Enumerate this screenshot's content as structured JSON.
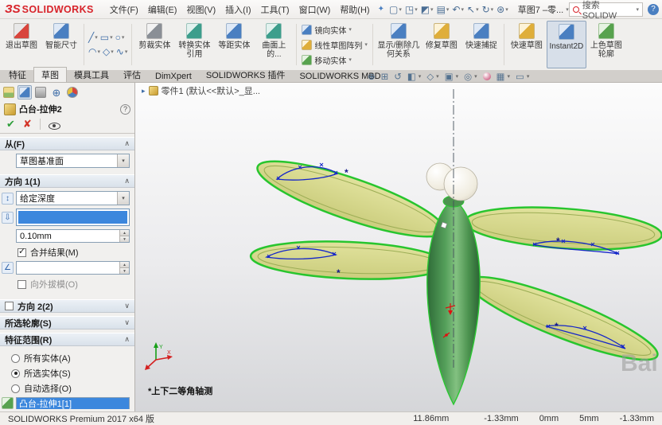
{
  "icons": {
    "dropdown": "▾",
    "spin_up": "▴",
    "spin_down": "▾",
    "chevron_up": "∧",
    "chevron_down": "∨",
    "flyout_right": "▸",
    "check": "✔",
    "cross": "✘",
    "check_small": "✓",
    "help": "?",
    "pin": "✦",
    "new_doc": "▢",
    "open_doc": "◳",
    "save_doc": "◩",
    "print_doc": "▤",
    "undo": "↶",
    "select": "↖",
    "rebuild": "↻",
    "options": "⊛",
    "line": "╱",
    "rectangle": "▭",
    "circle": "○",
    "arc": "◠",
    "polygon": "◇",
    "spline": "∿",
    "zoom_fit": "⊕",
    "zoom_area": "⊞",
    "previous_view": "↺",
    "section_view": "◧",
    "view_orientation": "◇",
    "display_style": "▣",
    "hide_items": "◎",
    "scene": "▦",
    "monitor": "▭",
    "reverse_direction": "↕",
    "depth": "⇩",
    "draft": "∠",
    "asterisk": "*"
  },
  "titlebar": {
    "logo_glyph": "ЗS",
    "logo_text": "SOLIDWORKS",
    "menus": [
      "文件(F)",
      "编辑(E)",
      "视图(V)",
      "插入(I)",
      "工具(T)",
      "窗口(W)",
      "帮助(H)"
    ],
    "doc_switcher": "草图7 –零...",
    "search_placeholder": "搜索 SOLIDW"
  },
  "ribbon": {
    "labels": [
      "退出草图",
      "智能尺寸",
      "剪裁实体",
      "转换实体引用",
      "等距实体",
      "曲面上的...",
      "镜向实体",
      "线性草图阵列",
      "移动实体",
      "显示/删除几何关系",
      "修复草图",
      "快速捕捉",
      "快速草图",
      "Instant2D",
      "上色草图轮廓"
    ]
  },
  "tabs": {
    "items": [
      "特征",
      "草图",
      "模具工具",
      "评估",
      "DimXpert",
      "SOLIDWORKS 插件",
      "SOLIDWORKS MBD"
    ]
  },
  "doc_tab": {
    "label": "零件1 (默认<<默认>_显..."
  },
  "property_manager": {
    "title": "凸台-拉伸2",
    "from_header": "从(F)",
    "from_plane": "草图基准面",
    "dir1_header": "方向 1(1)",
    "dir1_end_condition": "给定深度",
    "dir1_depth": "0.10mm",
    "merge_result": "合并结果(M)",
    "draft_outward": "向外拔模(O)",
    "dir2_header": "方向 2(2)",
    "contours_header": "所选轮廓(S)",
    "scope_header": "特征范围(R)",
    "scope_options": [
      "所有实体(A)",
      "所选实体(S)",
      "自动选择(O)"
    ],
    "scope_list_item": "凸台-拉伸1[1]"
  },
  "viewport": {
    "view_label": "*上下二等角轴测",
    "watermark": "Bai",
    "axis_labels": {
      "x": "X",
      "y": "Y"
    }
  },
  "statusbar": {
    "product": "SOLIDWORKS Premium 2017 x64 版",
    "coords": [
      "11.86mm",
      "-1.33mm",
      "0mm",
      "5mm",
      "-1.33mm"
    ]
  }
}
